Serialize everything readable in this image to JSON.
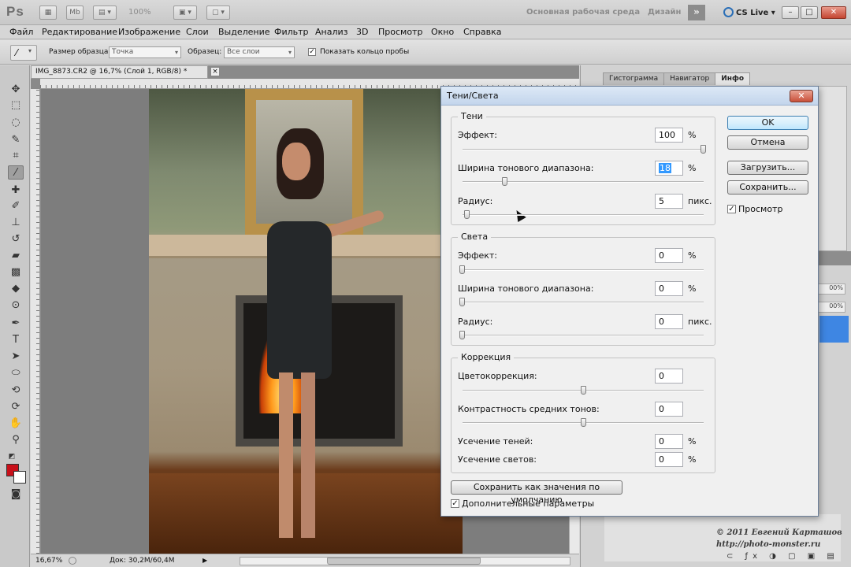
{
  "app": {
    "logo": "Ps",
    "zoom": "100%",
    "workspace_main": "Основная рабочая среда",
    "workspace_design": "Дизайн",
    "more": "»",
    "cs_live": "CS Live",
    "win_min": "–",
    "win_max": "□",
    "win_close": "✕"
  },
  "menu": [
    "Файл",
    "Редактирование",
    "Изображение",
    "Слои",
    "Выделение",
    "Фильтр",
    "Анализ",
    "3D",
    "Просмотр",
    "Окно",
    "Справка"
  ],
  "options": {
    "sample_size_label": "Размер образца:",
    "sample_size_value": "Точка",
    "sample_label": "Образец:",
    "sample_value": "Все слои",
    "show_ring_label": "Показать кольцо пробы",
    "show_ring_checked": "✓"
  },
  "document": {
    "tab_title": "IMG_8873.CR2 @ 16,7% (Слой 1, RGB/8) *",
    "tab_close": "×",
    "zoom": "16,67%",
    "doc_info": "Док: 30,2M/60,4M"
  },
  "panels": {
    "tabs": [
      "Гистограмма",
      "Навигатор",
      "Инфо"
    ],
    "active_tab": "Инфо",
    "pct1": "00%",
    "pct2": "00%",
    "copyright_line1": "© 2011 Евгений Карташов",
    "copyright_line2": "http://photo-monster.ru"
  },
  "dialog": {
    "title": "Тени/Света",
    "close": "✕",
    "shadows": {
      "legend": "Тени",
      "amount_label": "Эффект:",
      "amount": "100",
      "amount_unit": "%",
      "tonal_label": "Ширина тонового диапазона:",
      "tonal": "18",
      "tonal_unit": "%",
      "radius_label": "Радиус:",
      "radius": "5",
      "radius_unit": "пикс."
    },
    "highlights": {
      "legend": "Света",
      "amount_label": "Эффект:",
      "amount": "0",
      "amount_unit": "%",
      "tonal_label": "Ширина тонового диапазона:",
      "tonal": "0",
      "tonal_unit": "%",
      "radius_label": "Радиус:",
      "radius": "0",
      "radius_unit": "пикс."
    },
    "adjustments": {
      "legend": "Коррекция",
      "color_label": "Цветокоррекция:",
      "color": "0",
      "midtone_label": "Контрастность средних тонов:",
      "midtone": "0",
      "black_clip_label": "Усечение теней:",
      "black_clip": "0",
      "black_clip_unit": "%",
      "white_clip_label": "Усечение светов:",
      "white_clip": "0",
      "white_clip_unit": "%"
    },
    "buttons": {
      "ok": "OK",
      "cancel": "Отмена",
      "load": "Загрузить...",
      "save": "Сохранить...",
      "save_defaults": "Сохранить как значения по умолчанию"
    },
    "preview_label": "Просмотр",
    "preview_checked": "✓",
    "more_options_label": "Дополнительные параметры",
    "more_options_checked": "✓"
  }
}
